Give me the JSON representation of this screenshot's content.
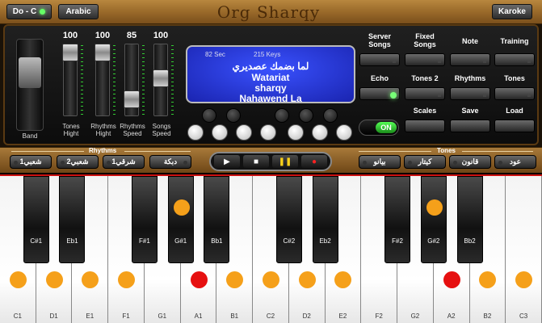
{
  "app": {
    "title": "Org Sharqy",
    "scale_button": "Do - C",
    "language_button": "Arabic",
    "karoke_button": "Karoke"
  },
  "faders": [
    {
      "value": "100",
      "label": "Tones\nHight",
      "level": 1.0
    },
    {
      "value": "100",
      "label": "Rhythms\nHight",
      "level": 1.0
    },
    {
      "value": "85",
      "label": "Rhythms\nSpeed",
      "level": 0.85
    },
    {
      "value": "100",
      "label": "Songs\nSpeed",
      "level": 1.0
    }
  ],
  "band_label": "Band",
  "lcd": {
    "seconds": "82 Sec",
    "keys": "215 Keys",
    "line1": "لما بضمك عصديري",
    "line2": "Watariat",
    "line3": "sharqy",
    "line4": "Nahawend  La"
  },
  "right_buttons": {
    "server_songs": "Server\nSongs",
    "fixed_songs": "Fixed\nSongs",
    "note": "Note",
    "training": "Training",
    "echo": "Echo",
    "tones2": "Tones 2",
    "rhythms": "Rhythms",
    "tones": "Tones",
    "scales": "Scales",
    "save": "Save",
    "load": "Load",
    "on_label": "ON"
  },
  "rhythms_group": {
    "label": "Rhythms",
    "buttons": [
      "شعبي1",
      "شعبي2",
      "شرقي1",
      "دبكة"
    ]
  },
  "tones_group": {
    "label": "Tones",
    "buttons": [
      "بيانو",
      "كيتار",
      "قانون",
      "عود"
    ]
  },
  "keyboard": {
    "white_keys": [
      {
        "label": "C1",
        "dot": "orange"
      },
      {
        "label": "D1",
        "dot": "orange"
      },
      {
        "label": "E1",
        "dot": "orange"
      },
      {
        "label": "F1",
        "dot": "orange"
      },
      {
        "label": "G1",
        "dot": "none"
      },
      {
        "label": "A1",
        "dot": "red"
      },
      {
        "label": "B1",
        "dot": "orange"
      },
      {
        "label": "C2",
        "dot": "orange"
      },
      {
        "label": "D2",
        "dot": "orange"
      },
      {
        "label": "E2",
        "dot": "orange"
      },
      {
        "label": "F2",
        "dot": "none"
      },
      {
        "label": "G2",
        "dot": "none"
      },
      {
        "label": "A2",
        "dot": "red"
      },
      {
        "label": "B2",
        "dot": "orange"
      },
      {
        "label": "C3",
        "dot": "orange"
      }
    ],
    "black_keys": [
      {
        "label": "C#1",
        "dot": false
      },
      {
        "label": "Eb1",
        "dot": false
      },
      {
        "label": "F#1",
        "dot": false
      },
      {
        "label": "G#1",
        "dot": true
      },
      {
        "label": "Bb1",
        "dot": false
      },
      {
        "label": "C#2",
        "dot": false
      },
      {
        "label": "Eb2",
        "dot": false
      },
      {
        "label": "F#2",
        "dot": false
      },
      {
        "label": "G#2",
        "dot": true
      },
      {
        "label": "Bb2",
        "dot": false
      }
    ]
  },
  "colors": {
    "lcd": "#2a3ee0",
    "dot_orange": "#f5a01a",
    "dot_red": "#e61010",
    "on_green": "#3ccf3c"
  }
}
